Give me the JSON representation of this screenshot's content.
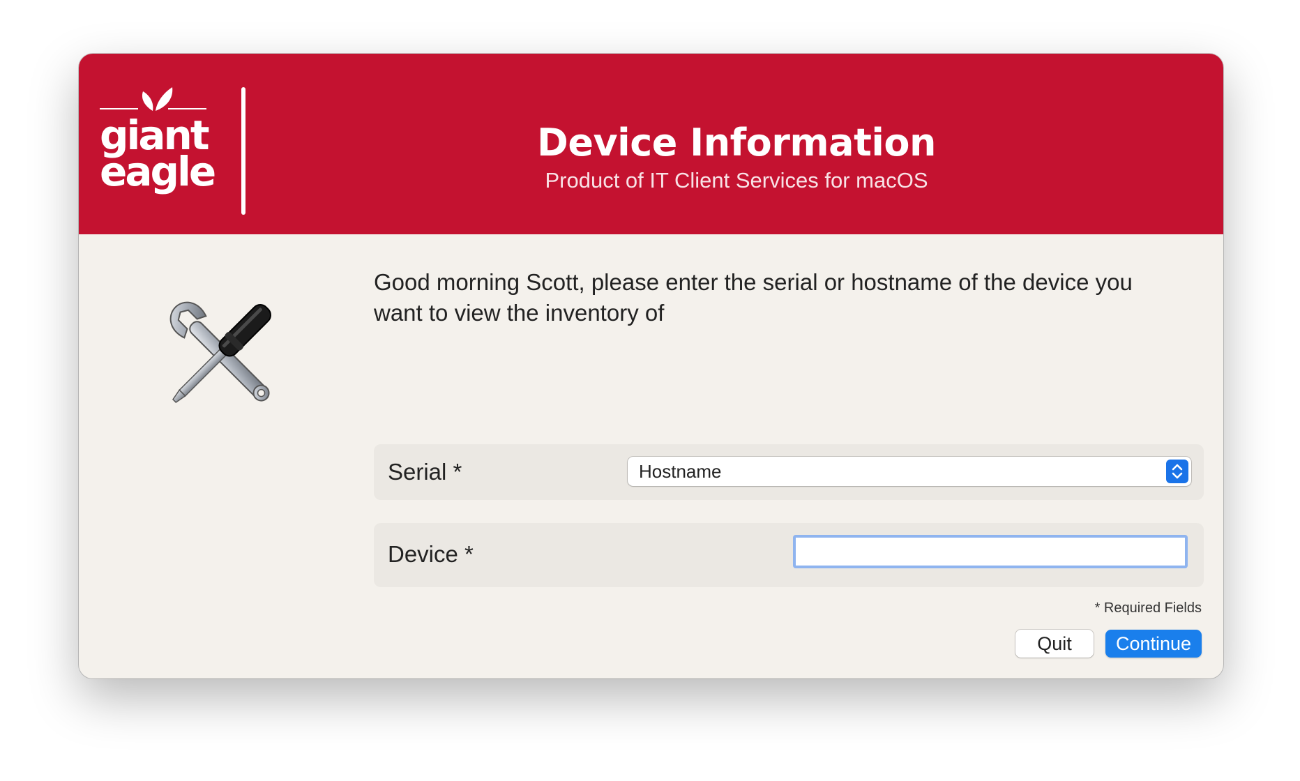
{
  "window": {
    "banner_color": "#c41230",
    "title": "Device Information",
    "subtitle": "Product of IT Client Services for macOS"
  },
  "logo": {
    "line1": "giant",
    "line2": "eagle",
    "icon": "giant-eagle-leaf-logo"
  },
  "main": {
    "icon": "tools-icon",
    "prompt": "Good morning Scott, please enter the serial or hostname of the device you want to view the inventory of"
  },
  "form": {
    "serial_label": "Serial *",
    "serial_select_value": "Hostname",
    "device_label": "Device *",
    "device_value": "",
    "required_note": "* Required Fields"
  },
  "buttons": {
    "quit": "Quit",
    "continue": "Continue",
    "accent": "#1a7fec"
  }
}
